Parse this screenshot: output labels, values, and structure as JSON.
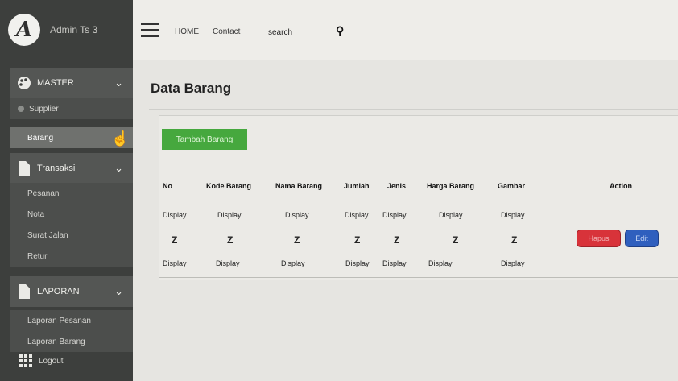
{
  "brand": {
    "logo_letter": "A",
    "name": "Admin Ts 3"
  },
  "sidebar": {
    "master": {
      "label": "MASTER",
      "items": [
        "Supplier",
        "Barang"
      ]
    },
    "transaksi": {
      "label": "Transaksi",
      "items": [
        "Pesanan",
        "Nota",
        "Surat Jalan",
        "Retur"
      ]
    },
    "laporan": {
      "label": "LAPORAN",
      "items": [
        "Laporan Pesanan",
        "Laporan Barang"
      ]
    },
    "logout": "Logout"
  },
  "topbar": {
    "links": [
      "HOME",
      "Contact"
    ],
    "search_value": "search"
  },
  "page": {
    "title": "Data Barang",
    "add_button": "Tambah Barang"
  },
  "table": {
    "headers": [
      "No",
      "Kode Barang",
      "Nama Barang",
      "Jumlah",
      "Jenis",
      "Harga Barang",
      "Gambar",
      "Action"
    ],
    "rows": [
      [
        "Display",
        "Display",
        "Display",
        "Display",
        "Display",
        "Display",
        "Display"
      ],
      [
        "Z",
        "Z",
        "Z",
        "Z",
        "Z",
        "Z",
        "Z"
      ],
      [
        "Display",
        "Display",
        "Display",
        "Display",
        "Display",
        "Display",
        "Display"
      ]
    ],
    "actions": {
      "delete": "Hapus",
      "edit": "Edit"
    }
  },
  "colors": {
    "sidebar": "#3d3f3d",
    "add_button": "#46a83e",
    "delete_button": "#d8333a",
    "edit_button": "#2f5fbe"
  }
}
